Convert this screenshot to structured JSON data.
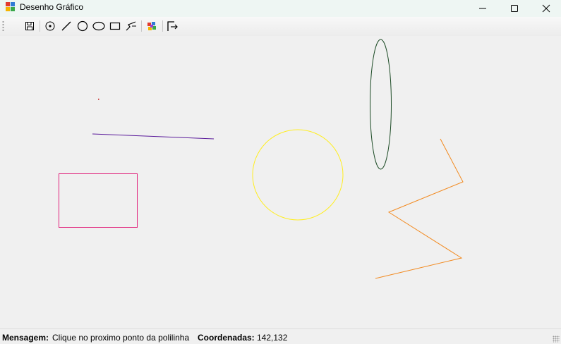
{
  "window": {
    "title": "Desenho Gráfico",
    "controls": {
      "minimize": "minimize",
      "maximize": "maximize",
      "close": "close"
    }
  },
  "toolbar": {
    "buttons": [
      {
        "name": "save-button",
        "icon": "save-icon"
      },
      {
        "name": "point-tool-button",
        "icon": "point-icon"
      },
      {
        "name": "line-tool-button",
        "icon": "line-icon"
      },
      {
        "name": "circle-tool-button",
        "icon": "circle-icon"
      },
      {
        "name": "ellipse-tool-button",
        "icon": "ellipse-icon"
      },
      {
        "name": "rectangle-tool-button",
        "icon": "rectangle-icon"
      },
      {
        "name": "polyline-tool-button",
        "icon": "polyline-icon"
      },
      {
        "name": "color-button",
        "icon": "palette-icon"
      },
      {
        "name": "exit-button",
        "icon": "exit-icon"
      }
    ]
  },
  "canvas": {
    "shapes": [
      {
        "type": "point",
        "color": "#c00000"
      },
      {
        "type": "line",
        "color": "#5a1a9a"
      },
      {
        "type": "rectangle",
        "color": "#e0207a"
      },
      {
        "type": "circle",
        "color": "#ffee20"
      },
      {
        "type": "ellipse",
        "color": "#1b4a24"
      },
      {
        "type": "polyline",
        "color": "#f28a20"
      }
    ]
  },
  "status": {
    "message_label": "Mensagem:",
    "message_value": "Clique no proximo ponto da polilinha",
    "coords_label": "Coordenadas:",
    "coords_value": "142,132"
  }
}
